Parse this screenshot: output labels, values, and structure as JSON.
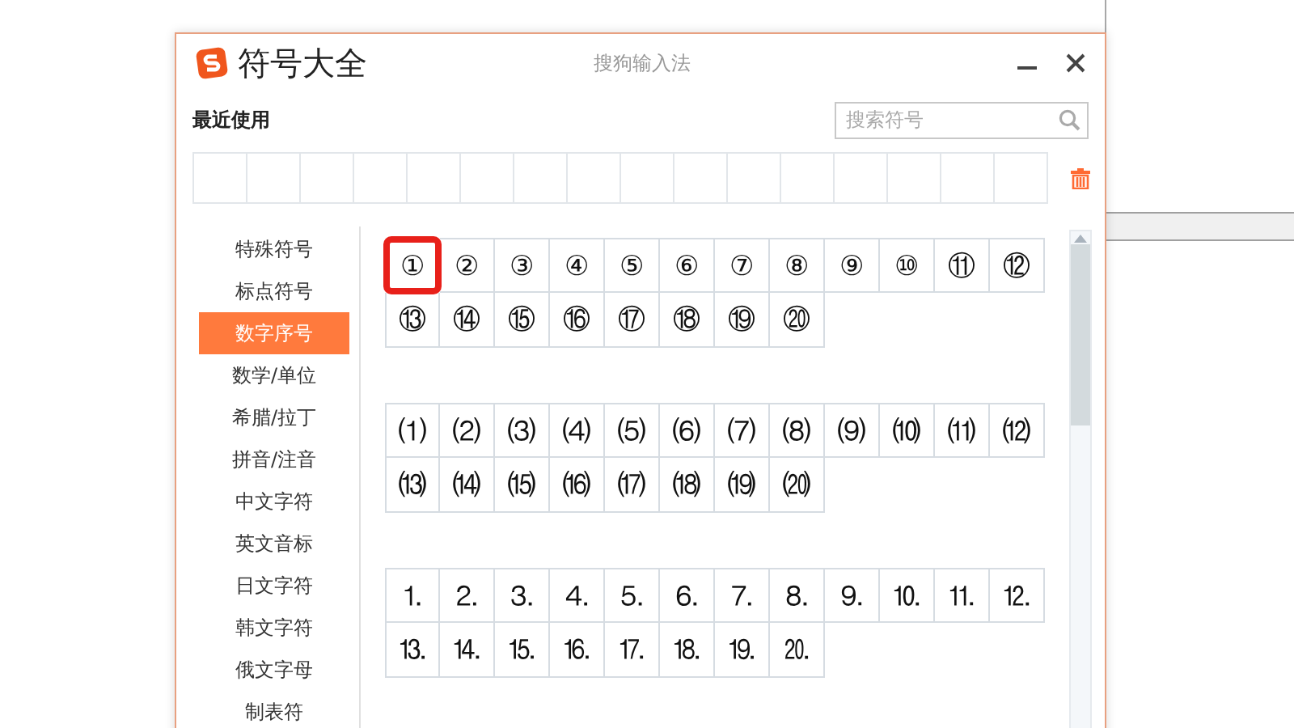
{
  "window": {
    "title": "符号大全",
    "app_name": "搜狗输入法"
  },
  "recent": {
    "label": "最近使用"
  },
  "search": {
    "placeholder": "搜索符号"
  },
  "sidebar": {
    "items": [
      {
        "label": "特殊符号",
        "selected": false
      },
      {
        "label": "标点符号",
        "selected": false
      },
      {
        "label": "数字序号",
        "selected": true
      },
      {
        "label": "数学/单位",
        "selected": false
      },
      {
        "label": "希腊/拉丁",
        "selected": false
      },
      {
        "label": "拼音/注音",
        "selected": false
      },
      {
        "label": "中文字符",
        "selected": false
      },
      {
        "label": "英文音标",
        "selected": false
      },
      {
        "label": "日文字符",
        "selected": false
      },
      {
        "label": "韩文字符",
        "selected": false
      },
      {
        "label": "俄文字母",
        "selected": false
      },
      {
        "label": "制表符",
        "selected": false
      }
    ]
  },
  "groups": [
    {
      "symbols": [
        {
          "text": "①",
          "selected": true
        },
        {
          "text": "②",
          "selected": false
        },
        {
          "text": "③",
          "selected": false
        },
        {
          "text": "④",
          "selected": false
        },
        {
          "text": "⑤",
          "selected": false
        },
        {
          "text": "⑥",
          "selected": false
        },
        {
          "text": "⑦",
          "selected": false
        },
        {
          "text": "⑧",
          "selected": false
        },
        {
          "text": "⑨",
          "selected": false
        },
        {
          "text": "⑩",
          "selected": false
        },
        {
          "text": "⑪",
          "selected": false
        },
        {
          "text": "⑫",
          "selected": false
        },
        {
          "text": "⑬",
          "selected": false
        },
        {
          "text": "⑭",
          "selected": false
        },
        {
          "text": "⑮",
          "selected": false
        },
        {
          "text": "⑯",
          "selected": false
        },
        {
          "text": "⑰",
          "selected": false
        },
        {
          "text": "⑱",
          "selected": false
        },
        {
          "text": "⑲",
          "selected": false
        },
        {
          "text": "⑳",
          "selected": false
        }
      ]
    },
    {
      "symbols": [
        {
          "text": "⑴",
          "selected": false
        },
        {
          "text": "⑵",
          "selected": false
        },
        {
          "text": "⑶",
          "selected": false
        },
        {
          "text": "⑷",
          "selected": false
        },
        {
          "text": "⑸",
          "selected": false
        },
        {
          "text": "⑹",
          "selected": false
        },
        {
          "text": "⑺",
          "selected": false
        },
        {
          "text": "⑻",
          "selected": false
        },
        {
          "text": "⑼",
          "selected": false
        },
        {
          "text": "⑽",
          "selected": false
        },
        {
          "text": "⑾",
          "selected": false
        },
        {
          "text": "⑿",
          "selected": false
        },
        {
          "text": "⒀",
          "selected": false
        },
        {
          "text": "⒁",
          "selected": false
        },
        {
          "text": "⒂",
          "selected": false
        },
        {
          "text": "⒃",
          "selected": false
        },
        {
          "text": "⒄",
          "selected": false
        },
        {
          "text": "⒅",
          "selected": false
        },
        {
          "text": "⒆",
          "selected": false
        },
        {
          "text": "⒇",
          "selected": false
        }
      ]
    },
    {
      "symbols": [
        {
          "text": "⒈",
          "selected": false
        },
        {
          "text": "⒉",
          "selected": false
        },
        {
          "text": "⒊",
          "selected": false
        },
        {
          "text": "⒋",
          "selected": false
        },
        {
          "text": "⒌",
          "selected": false
        },
        {
          "text": "⒍",
          "selected": false
        },
        {
          "text": "⒎",
          "selected": false
        },
        {
          "text": "⒏",
          "selected": false
        },
        {
          "text": "⒐",
          "selected": false
        },
        {
          "text": "⒑",
          "selected": false
        },
        {
          "text": "⒒",
          "selected": false
        },
        {
          "text": "⒓",
          "selected": false
        },
        {
          "text": "⒔",
          "selected": false
        },
        {
          "text": "⒕",
          "selected": false
        },
        {
          "text": "⒖",
          "selected": false
        },
        {
          "text": "⒗",
          "selected": false
        },
        {
          "text": "⒘",
          "selected": false
        },
        {
          "text": "⒙",
          "selected": false
        },
        {
          "text": "⒚",
          "selected": false
        },
        {
          "text": "⒛",
          "selected": false
        }
      ]
    }
  ]
}
